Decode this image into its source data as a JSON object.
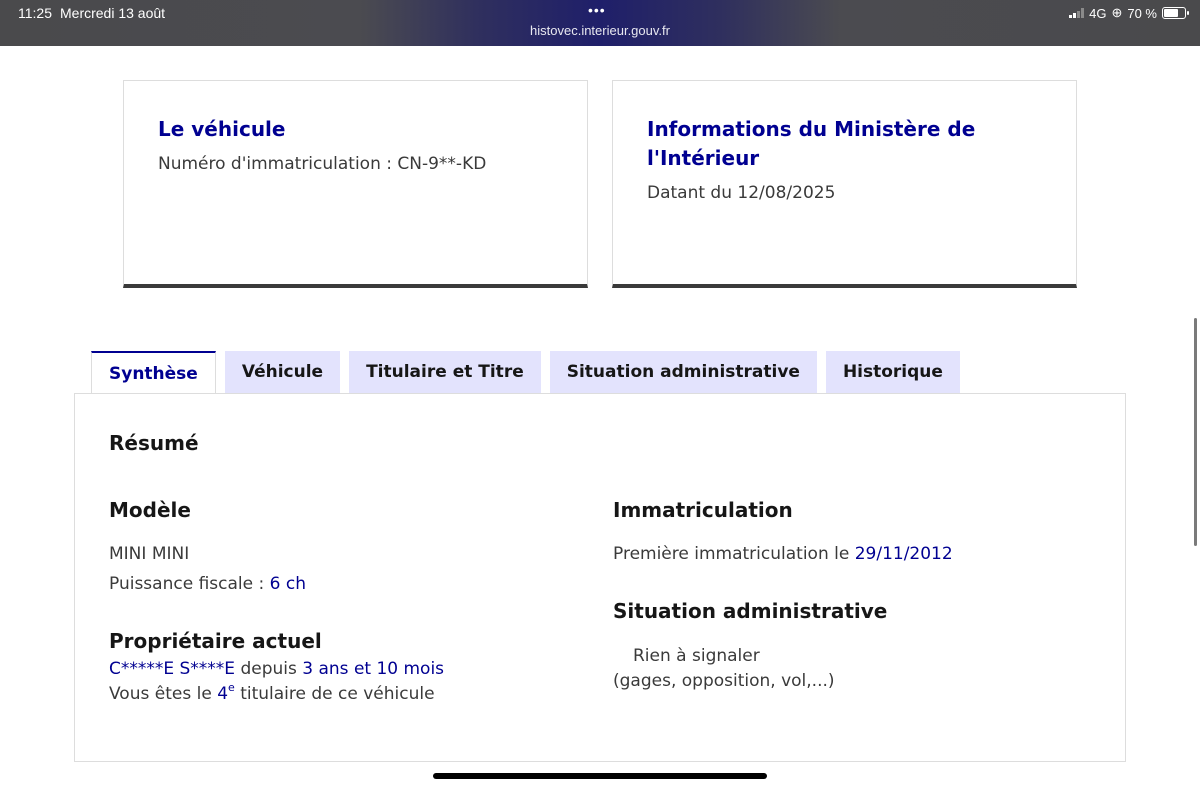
{
  "status_bar": {
    "time": "11:25",
    "date": "Mercredi 13 août",
    "dots": "•••",
    "url": "histovec.interieur.gouv.fr",
    "network": "4G",
    "battery": "70 %",
    "battery_level": 0.7
  },
  "cards": {
    "vehicle": {
      "title": "Le véhicule",
      "text": "Numéro d'immatriculation : CN-9**-KD"
    },
    "ministry": {
      "title": "Informations du Ministère de l'Intérieur",
      "text": "Datant du 12/08/2025"
    }
  },
  "tabs": [
    {
      "label": "Synthèse",
      "active": true
    },
    {
      "label": "Véhicule",
      "active": false
    },
    {
      "label": "Titulaire et Titre",
      "active": false
    },
    {
      "label": "Situation administrative",
      "active": false
    },
    {
      "label": "Historique",
      "active": false
    }
  ],
  "summary": {
    "heading": "Résumé",
    "model": {
      "heading": "Modèle",
      "name": "MINI MINI",
      "power_label": "Puissance fiscale : ",
      "power_value": "6 ch"
    },
    "owner": {
      "heading": "Propriétaire actuel",
      "name": "C*****E S****E",
      "since_label": " depuis ",
      "since_value": "3 ans et 10 mois",
      "rank_prefix": "Vous êtes le ",
      "rank_number": "4",
      "rank_sup": "e",
      "rank_suffix": " titulaire de ce véhicule"
    },
    "registration": {
      "heading": "Immatriculation",
      "label": "Première immatriculation le ",
      "date": "29/11/2012"
    },
    "admin": {
      "heading": "Situation administrative",
      "status": "Rien à signaler",
      "note": "(gages, opposition, vol,...)"
    }
  },
  "colors": {
    "accent": "#000091",
    "tab_bg": "#e3e3fd",
    "text": "#3a3a3a"
  }
}
